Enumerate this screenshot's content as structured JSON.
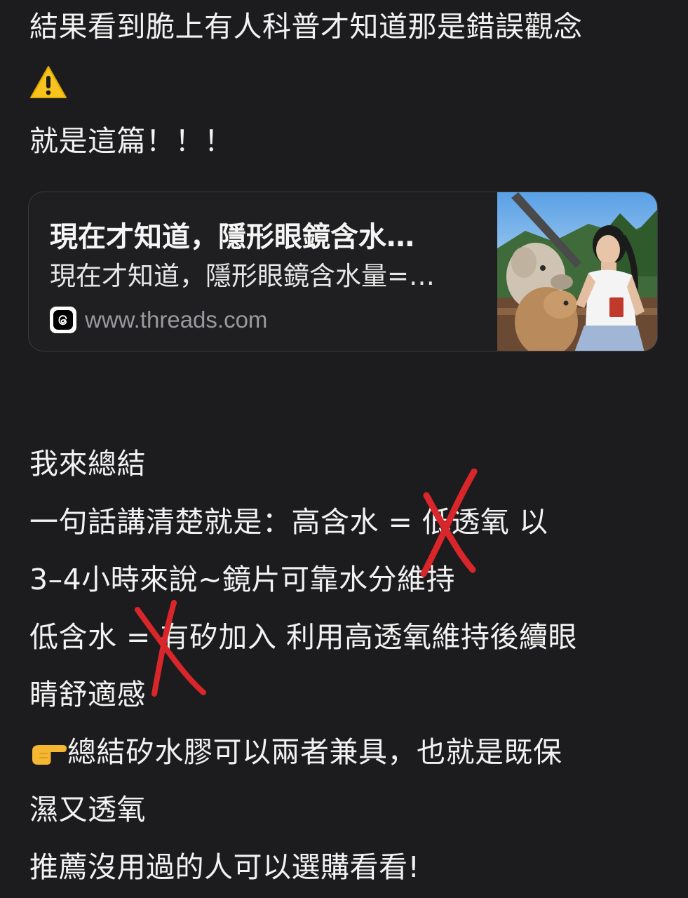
{
  "post": {
    "line1": "結果看到脆上有人科普才知道那是錯誤觀念",
    "warning_icon": "warning-emoji",
    "line2": "就是這篇！！！",
    "summary_heading": "我來總結",
    "line3": "一句話講清楚就是：高含水 = 低透氧 以",
    "line4": "3–4小時來說~鏡片可靠水分維持",
    "line5": "低含水 = 有矽加入 利用高透氧維持後續眼",
    "line6": "睛舒適感",
    "finger_icon": "pointing-finger-emoji",
    "line7": "總結矽水膠可以兩者兼具，也就是既保",
    "line8": "濕又透氧",
    "line9": "推薦沒用過的人可以選購看看!"
  },
  "link_card": {
    "title": "現在才知道，隱形眼鏡含水…",
    "description": "現在才知道，隱形眼鏡含水量=…",
    "domain": "www.threads.com",
    "site_icon": "threads-logo-icon",
    "thumbnail": "photo-woman-feeding-alpaca"
  },
  "annotations": {
    "mark_color": "#d8262b",
    "mark_icon": "red-x-mark"
  },
  "colors": {
    "background": "#1c1c1e",
    "text": "#f2f2f2",
    "card_border": "#3a3a3d",
    "domain_text": "#9a9a9e"
  }
}
